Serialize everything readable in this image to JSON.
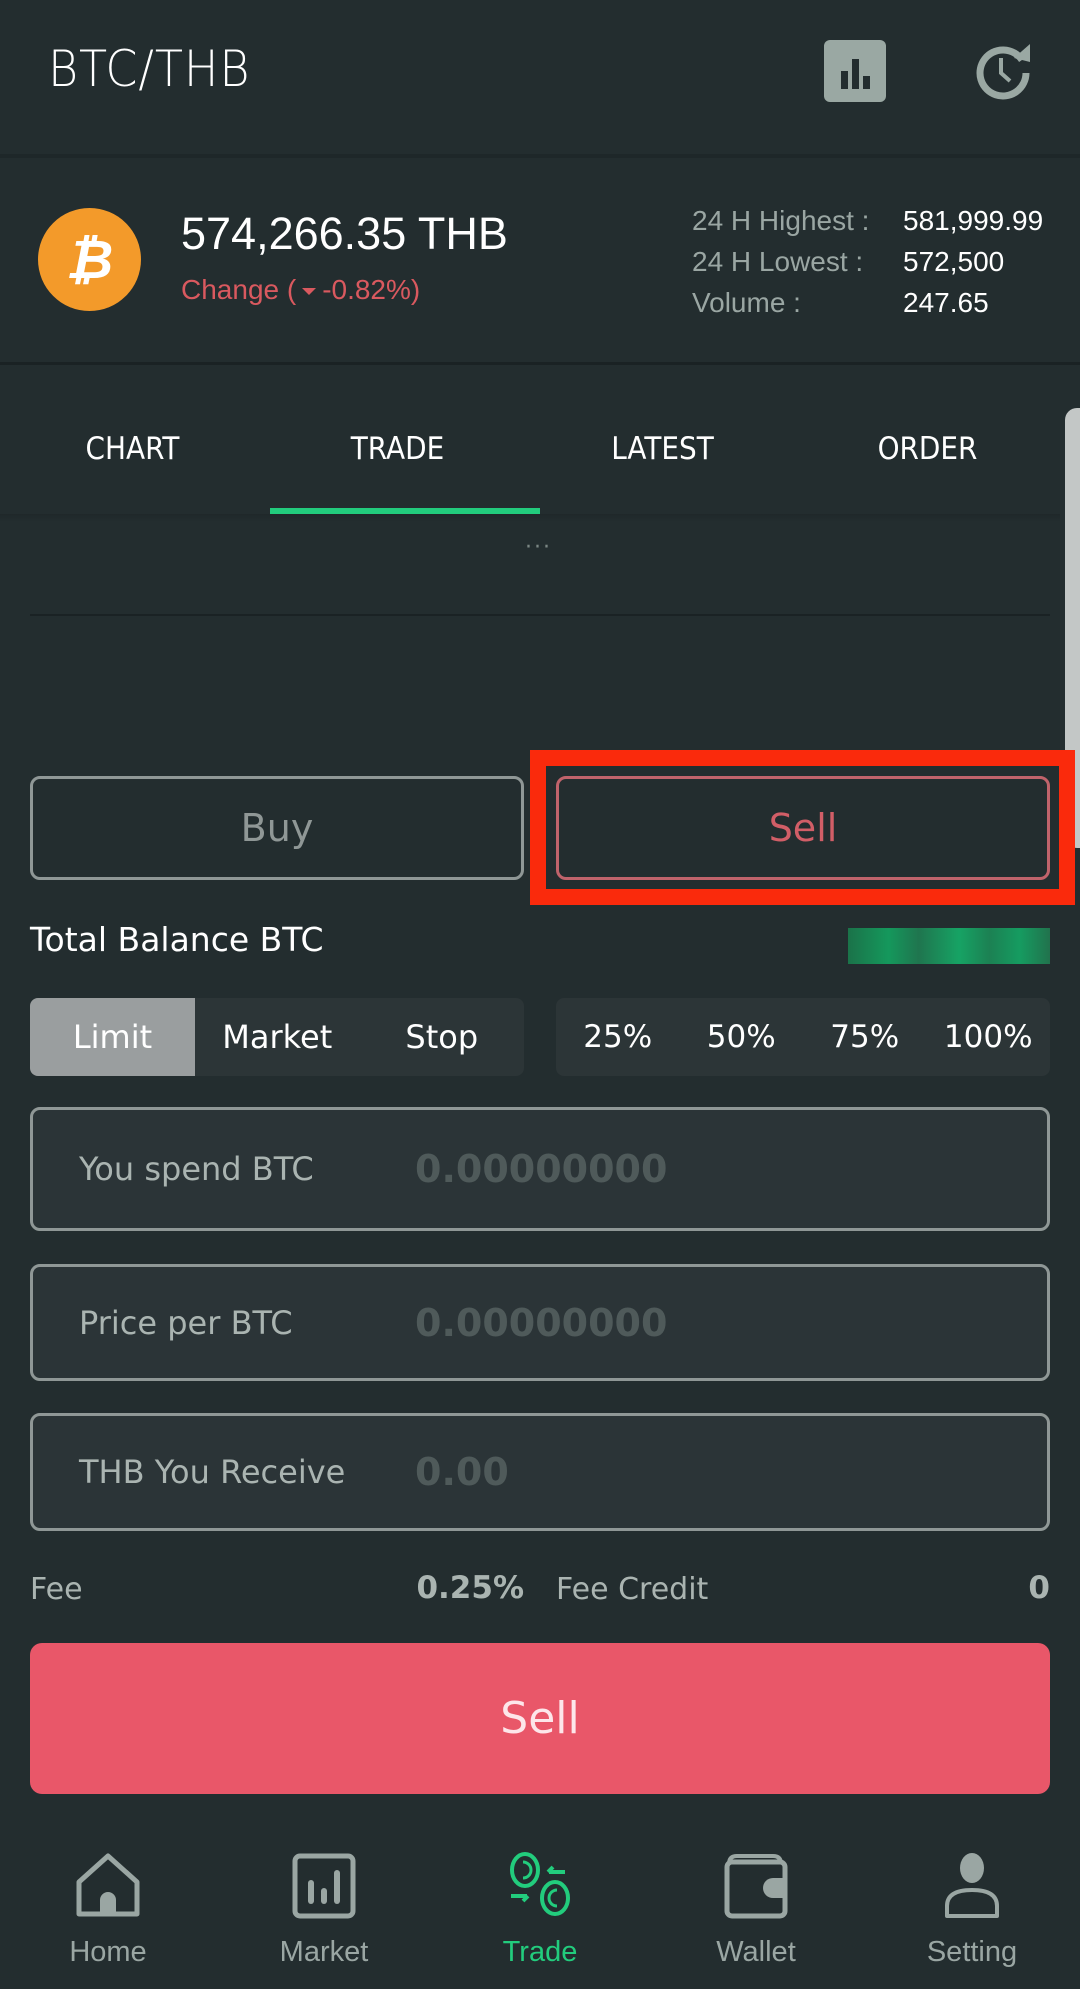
{
  "header": {
    "title": "BTC/THB",
    "icons": [
      "bar-chart-icon",
      "history-icon"
    ]
  },
  "ticker": {
    "coin_icon": "bitcoin-icon",
    "coin_symbol": "₿",
    "price": "574,266.35 THB",
    "change_prefix": "Change (",
    "change_value": "-0.82%)",
    "change_direction": "down",
    "stats": [
      {
        "label": "24 H Highest :",
        "value": "581,999.99"
      },
      {
        "label": "24 H Lowest :",
        "value": "572,500"
      },
      {
        "label": "Volume :",
        "value": "247.65"
      }
    ]
  },
  "tabs": [
    {
      "label": "CHART",
      "active": false
    },
    {
      "label": "TRADE",
      "active": true
    },
    {
      "label": "LATEST",
      "active": false
    },
    {
      "label": "ORDER",
      "active": false
    }
  ],
  "drag_handle": "···",
  "trade": {
    "buy_label": "Buy",
    "sell_label": "Sell",
    "selected_side": "Sell",
    "balance_label": "Total Balance BTC",
    "balance_value_hidden": true,
    "order_types": [
      {
        "label": "Limit",
        "active": true
      },
      {
        "label": "Market",
        "active": false
      },
      {
        "label": "Stop",
        "active": false
      }
    ],
    "percent_options": [
      "25%",
      "50%",
      "75%",
      "100%"
    ],
    "fields": {
      "spend": {
        "label": "You spend BTC",
        "placeholder": "0.00000000",
        "value": ""
      },
      "price": {
        "label": "Price per BTC",
        "placeholder": "0.00000000",
        "value": ""
      },
      "receive": {
        "label": "THB You Receive",
        "placeholder": "0.00",
        "value": ""
      }
    },
    "fee_label": "Fee",
    "fee_value": "0.25%",
    "fee_credit_label": "Fee Credit",
    "fee_credit_value": "0",
    "submit_label": "Sell"
  },
  "bottom_nav": [
    {
      "label": "Home",
      "icon": "home-icon",
      "active": false
    },
    {
      "label": "Market",
      "icon": "market-icon",
      "active": false
    },
    {
      "label": "Trade",
      "icon": "trade-icon",
      "active": true
    },
    {
      "label": "Wallet",
      "icon": "wallet-icon",
      "active": false
    },
    {
      "label": "Setting",
      "icon": "user-icon",
      "active": false
    }
  ],
  "colors": {
    "background": "#232d2f",
    "accent_green": "#22cc7d",
    "sell_red": "#e95769",
    "change_red": "#d9595f",
    "bitcoin_orange": "#f39a2a",
    "highlight_red": "#fa2a0c"
  }
}
